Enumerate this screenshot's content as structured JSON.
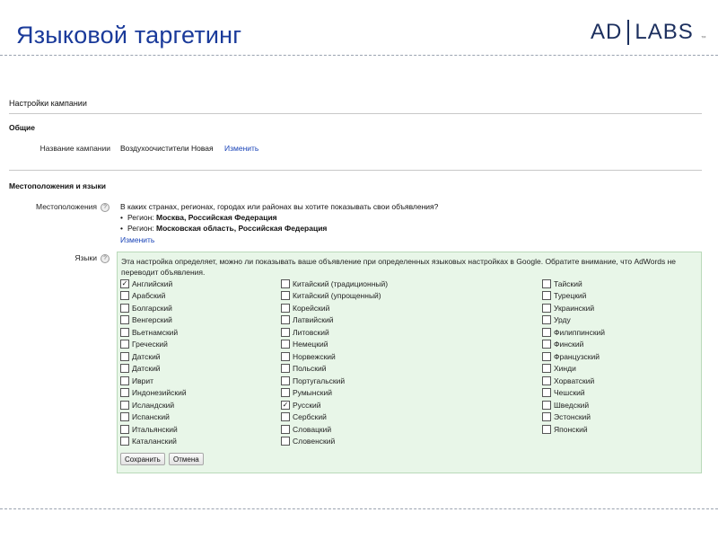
{
  "slide": {
    "title": "Языковой таргетинг",
    "logo_left": "AD",
    "logo_right": "LABS",
    "logo_tm": "™"
  },
  "settings": {
    "heading": "Настройки кампании",
    "general": {
      "heading": "Общие",
      "name_label": "Название кампании",
      "name_value": "Воздухоочистители Новая",
      "edit_link": "Изменить"
    },
    "locations": {
      "heading": "Местоположения и языки",
      "label": "Местоположения",
      "question": "В каких странах, регионах, городах или районах вы хотите показывать свои объявления?",
      "regions": [
        {
          "prefix": "Регион: ",
          "value": "Москва, Российская Федерация"
        },
        {
          "prefix": "Регион: ",
          "value": "Московская область, Российская Федерация"
        }
      ],
      "edit_link": "Изменить"
    },
    "languages": {
      "label": "Языки",
      "description": "Эта настройка определяет, можно ли показывать ваше объявление при определенных языковых настройках в Google. Обратите внимание, что AdWords не переводит объявления.",
      "columns": [
        [
          {
            "label": "Английский",
            "checked": true
          },
          {
            "label": "Арабский",
            "checked": false
          },
          {
            "label": "Болгарский",
            "checked": false
          },
          {
            "label": "Венгерский",
            "checked": false
          },
          {
            "label": "Вьетнамский",
            "checked": false
          },
          {
            "label": "Греческий",
            "checked": false
          },
          {
            "label": "Датский",
            "checked": false
          },
          {
            "label": "Датский",
            "checked": false
          },
          {
            "label": "Иврит",
            "checked": false
          },
          {
            "label": "Индонезийский",
            "checked": false
          },
          {
            "label": "Исландский",
            "checked": false
          },
          {
            "label": "Испанский",
            "checked": false
          },
          {
            "label": "Итальянский",
            "checked": false
          },
          {
            "label": "Каталанский",
            "checked": false
          }
        ],
        [
          {
            "label": "Китайский (традиционный)",
            "checked": false
          },
          {
            "label": "Китайский (упрощенный)",
            "checked": false
          },
          {
            "label": "Корейский",
            "checked": false
          },
          {
            "label": "Латвийский",
            "checked": false
          },
          {
            "label": "Литовский",
            "checked": false
          },
          {
            "label": "Немецкий",
            "checked": false
          },
          {
            "label": "Норвежский",
            "checked": false
          },
          {
            "label": "Польский",
            "checked": false
          },
          {
            "label": "Португальский",
            "checked": false
          },
          {
            "label": "Румынский",
            "checked": false
          },
          {
            "label": "Русский",
            "checked": true
          },
          {
            "label": "Сербский",
            "checked": false
          },
          {
            "label": "Словацкий",
            "checked": false
          },
          {
            "label": "Словенский",
            "checked": false
          }
        ],
        [
          {
            "label": "Тайский",
            "checked": false
          },
          {
            "label": "Турецкий",
            "checked": false
          },
          {
            "label": "Украинский",
            "checked": false
          },
          {
            "label": "Урду",
            "checked": false
          },
          {
            "label": "Филиппинский",
            "checked": false
          },
          {
            "label": "Финский",
            "checked": false
          },
          {
            "label": "Французский",
            "checked": false
          },
          {
            "label": "Хинди",
            "checked": false
          },
          {
            "label": "Хорватский",
            "checked": false
          },
          {
            "label": "Чешский",
            "checked": false
          },
          {
            "label": "Шведский",
            "checked": false
          },
          {
            "label": "Эстонский",
            "checked": false
          },
          {
            "label": "Японский",
            "checked": false
          }
        ]
      ],
      "save_label": "Сохранить",
      "cancel_label": "Отмена"
    },
    "help_icon_glyph": "?"
  }
}
